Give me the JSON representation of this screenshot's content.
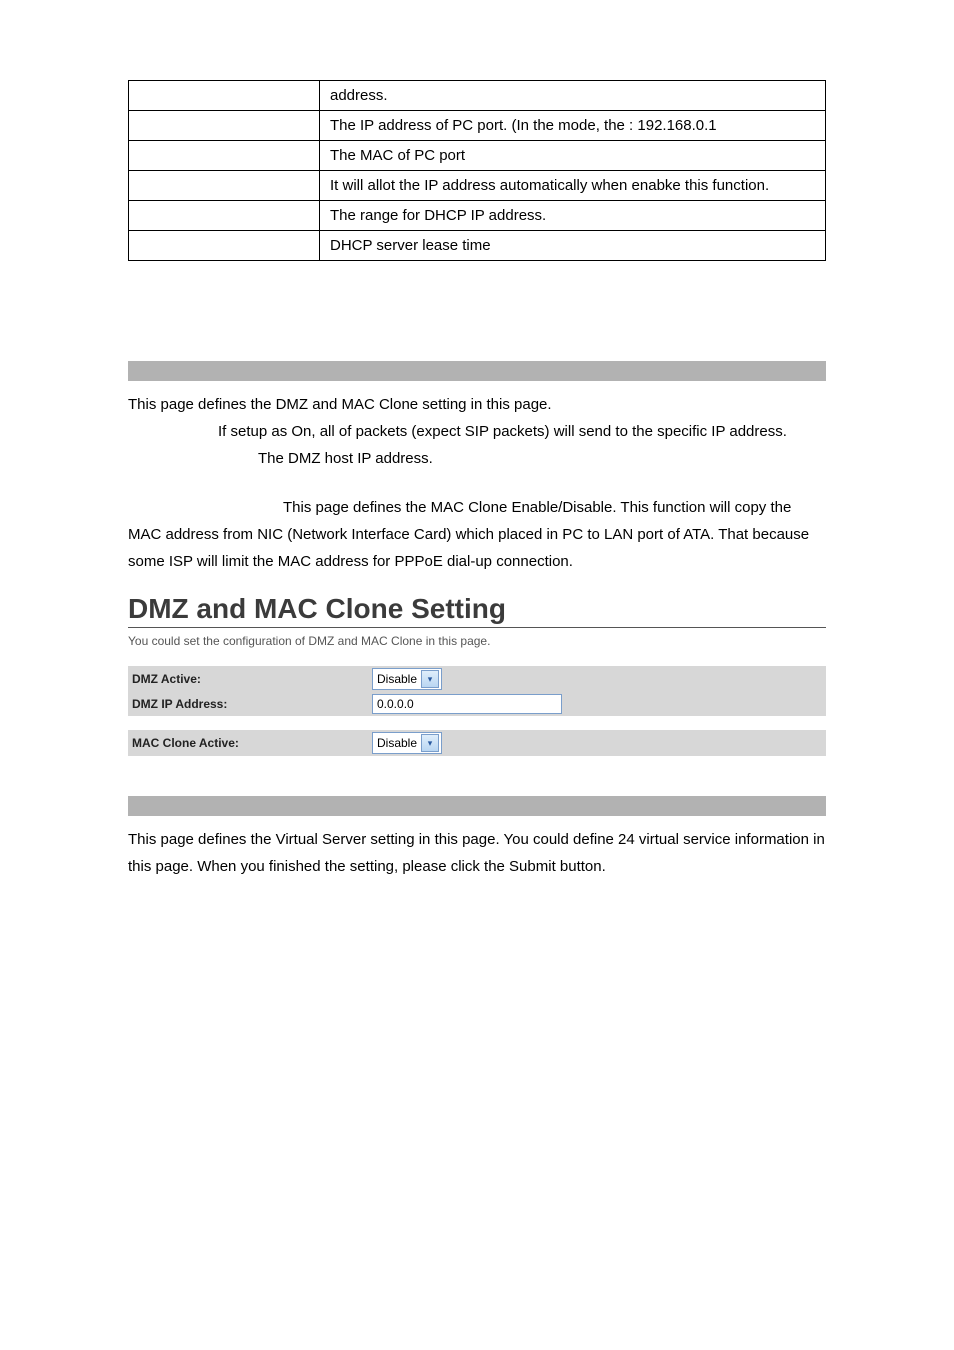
{
  "table_rows": [
    {
      "left": "",
      "right": "address."
    },
    {
      "left": "",
      "right": "The  IP  address of PC port. (In the                           mode,  the                       : 192.168.0.1"
    },
    {
      "left": "",
      "right": "The MAC of PC port"
    },
    {
      "left": "",
      "right": "It will allot the IP address automatically when enabke this function."
    },
    {
      "left": "",
      "right": "The range for DHCP IP address."
    },
    {
      "left": "",
      "right": "DHCP server lease time"
    }
  ],
  "dmz_section": {
    "intro": "This page defines the DMZ and MAC Clone setting in this page.",
    "line1": "If setup as On, all of packets (expect SIP packets) will send to the specific IP address.",
    "line2": "The DMZ host IP address.",
    "mac_clone_para": "This page defines the MAC Clone Enable/Disable. This function will copy the MAC address from NIC (Network Interface Card) which placed in PC to LAN port of ATA. That because some ISP will limit the MAC address for PPPoE dial-up connection."
  },
  "screenshot": {
    "title": "DMZ and MAC Clone Setting",
    "subtitle": "You could set the configuration of DMZ and MAC Clone in this page.",
    "rows": {
      "dmz_active_label": "DMZ Active:",
      "dmz_active_value": "Disable",
      "dmz_ip_label": "DMZ IP Address:",
      "dmz_ip_value": "0.0.0.0",
      "mac_clone_label": "MAC Clone Active:",
      "mac_clone_value": "Disable"
    }
  },
  "vserver_section": {
    "text": "This page defines the Virtual Server setting in this page. You could define 24 virtual service information in this page. When you finished the setting, please click the Submit button."
  }
}
